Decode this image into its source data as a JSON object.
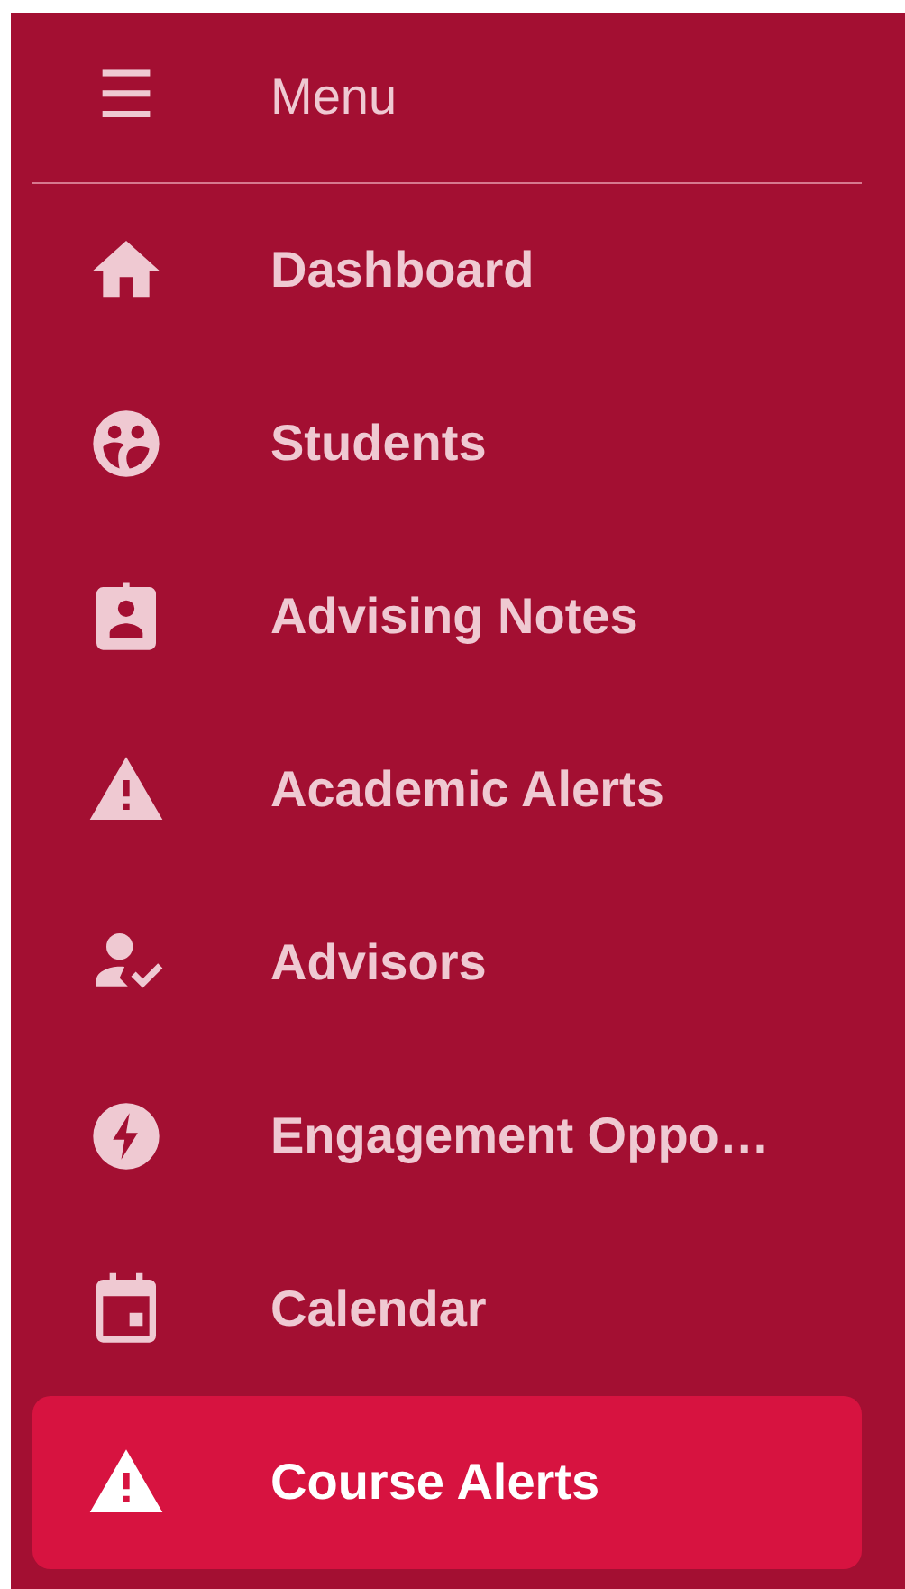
{
  "menu": {
    "icon": "☰",
    "label": "Menu"
  },
  "items": [
    {
      "label": "Dashboard",
      "selected": false
    },
    {
      "label": "Students",
      "selected": false
    },
    {
      "label": "Advising Notes",
      "selected": false
    },
    {
      "label": "Academic Alerts",
      "selected": false
    },
    {
      "label": "Advisors",
      "selected": false
    },
    {
      "label": "Engagement Oppo…",
      "selected": false
    },
    {
      "label": "Calendar",
      "selected": false
    },
    {
      "label": "Course Alerts",
      "selected": true
    }
  ]
}
